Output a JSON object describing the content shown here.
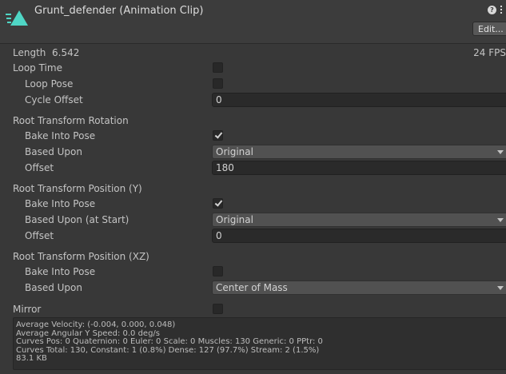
{
  "header": {
    "title": "Grunt_defender (Animation Clip)",
    "edit_label": "Edit...",
    "help_glyph": "?",
    "accent_color": "#4fd6c5"
  },
  "length": {
    "label": "Length",
    "value": "6.542",
    "fps": "24 FPS"
  },
  "loop_time": {
    "label": "Loop Time",
    "checked": false
  },
  "loop_pose": {
    "label": "Loop Pose",
    "checked": false
  },
  "cycle_offset": {
    "label": "Cycle Offset",
    "value": "0"
  },
  "root_rotation": {
    "header": "Root Transform Rotation",
    "bake_label": "Bake Into Pose",
    "bake_checked": true,
    "based_label": "Based Upon",
    "based_value": "Original",
    "offset_label": "Offset",
    "offset_value": "180"
  },
  "root_pos_y": {
    "header": "Root Transform Position (Y)",
    "bake_label": "Bake Into Pose",
    "bake_checked": true,
    "based_label": "Based Upon (at Start)",
    "based_value": "Original",
    "offset_label": "Offset",
    "offset_value": "0"
  },
  "root_pos_xz": {
    "header": "Root Transform Position (XZ)",
    "bake_label": "Bake Into Pose",
    "bake_checked": false,
    "based_label": "Based Upon",
    "based_value": "Center of Mass"
  },
  "mirror": {
    "label": "Mirror",
    "checked": false
  },
  "info": {
    "line1": "Average Velocity: (-0.004, 0.000, 0.048)",
    "line2": "Average Angular Y Speed: 0.0 deg/s",
    "line3": "Curves Pos: 0 Quaternion: 0 Euler: 0 Scale: 0 Muscles: 130 Generic: 0 PPtr: 0",
    "line4": "Curves Total: 130, Constant: 1 (0.8%) Dense: 127 (97.7%) Stream: 2 (1.5%)",
    "line5": "83.1 KB"
  }
}
